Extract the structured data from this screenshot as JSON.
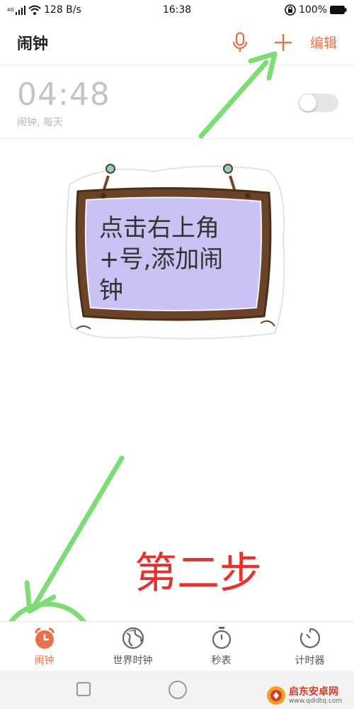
{
  "status_bar": {
    "network": "4G",
    "speed": "128 B/s",
    "time": "16:38",
    "battery": "100%"
  },
  "header": {
    "title": "闹钟",
    "edit_label": "编辑",
    "accent_color": "#e8704a"
  },
  "alarms": [
    {
      "time": "04:48",
      "description": "闹钟, 每天",
      "enabled": false
    }
  ],
  "annotation": {
    "sign_text": "点击右上角+号,添加闹钟",
    "step_label": "第二步",
    "arrow_color": "#7ddc74",
    "step_color": "#e8302c"
  },
  "tabs": [
    {
      "label": "闹钟",
      "icon": "alarm-clock-icon",
      "active": true
    },
    {
      "label": "世界时钟",
      "icon": "globe-icon",
      "active": false
    },
    {
      "label": "秒表",
      "icon": "stopwatch-icon",
      "active": false
    },
    {
      "label": "计时器",
      "icon": "timer-icon",
      "active": false
    }
  ],
  "watermark": {
    "name": "启东安卓网",
    "url": "www.qdldtq.com"
  }
}
